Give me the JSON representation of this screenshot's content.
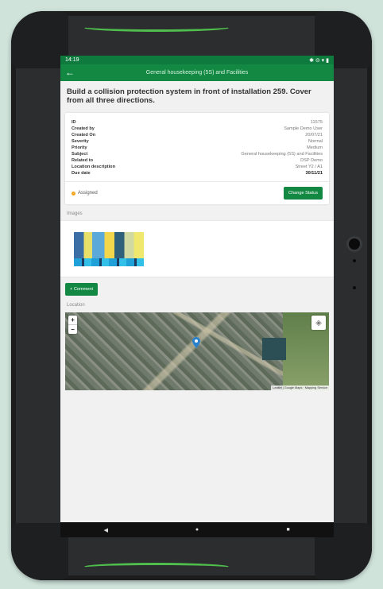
{
  "status_bar": {
    "time": "14:19",
    "right_icons": "✱ ⊝ ▾ ▮"
  },
  "app_bar": {
    "title": "General housekeeping (5S) and Facilities"
  },
  "task": {
    "title": "Build a collision protection system in front of installation 259. Cover from all three directions.",
    "details": [
      {
        "key": "ID",
        "value": "11575"
      },
      {
        "key": "Created by",
        "value": "Sample Demo User"
      },
      {
        "key": "Created On",
        "value": "20/07/21"
      },
      {
        "key": "Severity",
        "value": "Normal"
      },
      {
        "key": "Priority",
        "value": "Medium"
      },
      {
        "key": "Subject",
        "value": "General housekeeping (5S) and Facilities"
      },
      {
        "key": "Related to",
        "value": "DSP Demo"
      },
      {
        "key": "Location description",
        "value": "Street Y2 / A1"
      },
      {
        "key": "Due date",
        "value": "30/11/21"
      }
    ],
    "status": "Assigned",
    "change_status_label": "Change Status"
  },
  "sections": {
    "images_label": "Images",
    "comment_button": "+ Comment",
    "location_label": "Location"
  },
  "map": {
    "zoom_in": "+",
    "zoom_out": "−",
    "attribution": "Leaflet | Google Maps · Mapping Service"
  },
  "colors": {
    "primary": "#128842",
    "status_dot": "#f5a623"
  }
}
